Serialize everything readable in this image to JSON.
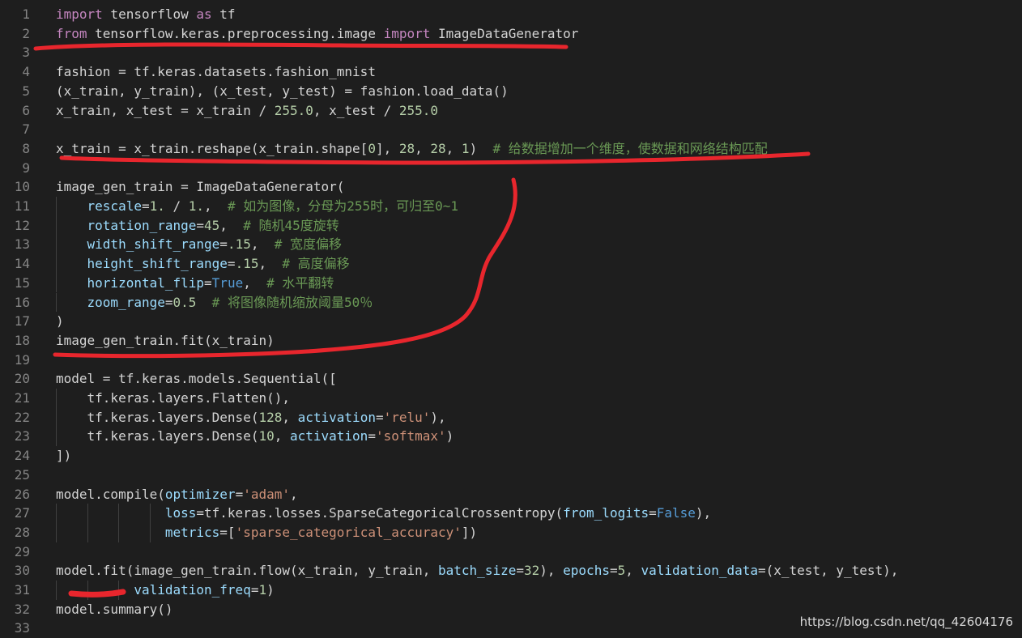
{
  "editor": {
    "lines": [
      {
        "n": "1",
        "guides": 0,
        "tokens": [
          {
            "t": "import",
            "c": "kw"
          },
          {
            "t": " tensorflow "
          },
          {
            "t": "as",
            "c": "kw"
          },
          {
            "t": " tf"
          }
        ]
      },
      {
        "n": "2",
        "guides": 0,
        "tokens": [
          {
            "t": "from",
            "c": "kw"
          },
          {
            "t": " tensorflow.keras.preprocessing.image "
          },
          {
            "t": "import",
            "c": "kw"
          },
          {
            "t": " ImageDataGenerator"
          }
        ]
      },
      {
        "n": "3",
        "guides": 0,
        "tokens": []
      },
      {
        "n": "4",
        "guides": 0,
        "tokens": [
          {
            "t": "fashion = tf.keras.datasets.fashion_mnist"
          }
        ]
      },
      {
        "n": "5",
        "guides": 0,
        "tokens": [
          {
            "t": "(x_train, y_train), (x_test, y_test) = fashion.load_data()"
          }
        ]
      },
      {
        "n": "6",
        "guides": 0,
        "tokens": [
          {
            "t": "x_train, x_test = x_train / "
          },
          {
            "t": "255.0",
            "c": "nm"
          },
          {
            "t": ", x_test / "
          },
          {
            "t": "255.0",
            "c": "nm"
          }
        ]
      },
      {
        "n": "7",
        "guides": 0,
        "tokens": []
      },
      {
        "n": "8",
        "guides": 0,
        "tokens": [
          {
            "t": "x_train = x_train.reshape(x_train.shape["
          },
          {
            "t": "0",
            "c": "nm"
          },
          {
            "t": "], "
          },
          {
            "t": "28",
            "c": "nm"
          },
          {
            "t": ", "
          },
          {
            "t": "28",
            "c": "nm"
          },
          {
            "t": ", "
          },
          {
            "t": "1",
            "c": "nm"
          },
          {
            "t": ")  "
          },
          {
            "t": "# 给数据增加一个维度，使数据和网络结构匹配",
            "c": "cm"
          }
        ]
      },
      {
        "n": "9",
        "guides": 0,
        "tokens": []
      },
      {
        "n": "10",
        "guides": 0,
        "tokens": [
          {
            "t": "image_gen_train = ImageDataGenerator("
          }
        ]
      },
      {
        "n": "11",
        "guides": 1,
        "tokens": [
          {
            "t": "    "
          },
          {
            "t": "rescale",
            "c": "va"
          },
          {
            "t": "="
          },
          {
            "t": "1.",
            "c": "nm"
          },
          {
            "t": " / "
          },
          {
            "t": "1.",
            "c": "nm"
          },
          {
            "t": ",  "
          },
          {
            "t": "# 如为图像，分母为255时，可归至0~1",
            "c": "cm"
          }
        ]
      },
      {
        "n": "12",
        "guides": 1,
        "tokens": [
          {
            "t": "    "
          },
          {
            "t": "rotation_range",
            "c": "va"
          },
          {
            "t": "="
          },
          {
            "t": "45",
            "c": "nm"
          },
          {
            "t": ",  "
          },
          {
            "t": "# 随机45度旋转",
            "c": "cm"
          }
        ]
      },
      {
        "n": "13",
        "guides": 1,
        "tokens": [
          {
            "t": "    "
          },
          {
            "t": "width_shift_range",
            "c": "va"
          },
          {
            "t": "="
          },
          {
            "t": ".15",
            "c": "nm"
          },
          {
            "t": ",  "
          },
          {
            "t": "# 宽度偏移",
            "c": "cm"
          }
        ]
      },
      {
        "n": "14",
        "guides": 1,
        "tokens": [
          {
            "t": "    "
          },
          {
            "t": "height_shift_range",
            "c": "va"
          },
          {
            "t": "="
          },
          {
            "t": ".15",
            "c": "nm"
          },
          {
            "t": ",  "
          },
          {
            "t": "# 高度偏移",
            "c": "cm"
          }
        ]
      },
      {
        "n": "15",
        "guides": 1,
        "tokens": [
          {
            "t": "    "
          },
          {
            "t": "horizontal_flip",
            "c": "va"
          },
          {
            "t": "="
          },
          {
            "t": "True",
            "c": "bl"
          },
          {
            "t": ",  "
          },
          {
            "t": "# 水平翻转",
            "c": "cm"
          }
        ]
      },
      {
        "n": "16",
        "guides": 1,
        "tokens": [
          {
            "t": "    "
          },
          {
            "t": "zoom_range",
            "c": "va"
          },
          {
            "t": "="
          },
          {
            "t": "0.5",
            "c": "nm"
          },
          {
            "t": "  "
          },
          {
            "t": "# 将图像随机缩放阈量50％",
            "c": "cm"
          }
        ]
      },
      {
        "n": "17",
        "guides": 0,
        "tokens": [
          {
            "t": ")"
          }
        ]
      },
      {
        "n": "18",
        "guides": 0,
        "tokens": [
          {
            "t": "image_gen_train.fit(x_train)"
          }
        ]
      },
      {
        "n": "19",
        "guides": 0,
        "tokens": []
      },
      {
        "n": "20",
        "guides": 0,
        "tokens": [
          {
            "t": "model = tf.keras.models.Sequential(["
          }
        ]
      },
      {
        "n": "21",
        "guides": 1,
        "tokens": [
          {
            "t": "    tf.keras.layers.Flatten(),"
          }
        ]
      },
      {
        "n": "22",
        "guides": 1,
        "tokens": [
          {
            "t": "    tf.keras.layers.Dense("
          },
          {
            "t": "128",
            "c": "nm"
          },
          {
            "t": ", "
          },
          {
            "t": "activation",
            "c": "va"
          },
          {
            "t": "="
          },
          {
            "t": "'relu'",
            "c": "st"
          },
          {
            "t": "),"
          }
        ]
      },
      {
        "n": "23",
        "guides": 1,
        "tokens": [
          {
            "t": "    tf.keras.layers.Dense("
          },
          {
            "t": "10",
            "c": "nm"
          },
          {
            "t": ", "
          },
          {
            "t": "activation",
            "c": "va"
          },
          {
            "t": "="
          },
          {
            "t": "'softmax'",
            "c": "st"
          },
          {
            "t": ")"
          }
        ]
      },
      {
        "n": "24",
        "guides": 0,
        "tokens": [
          {
            "t": "])"
          }
        ]
      },
      {
        "n": "25",
        "guides": 0,
        "tokens": []
      },
      {
        "n": "26",
        "guides": 0,
        "tokens": [
          {
            "t": "model.compile("
          },
          {
            "t": "optimizer",
            "c": "va"
          },
          {
            "t": "="
          },
          {
            "t": "'adam'",
            "c": "st"
          },
          {
            "t": ","
          }
        ]
      },
      {
        "n": "27",
        "guides": 4,
        "tokens": [
          {
            "t": "              "
          },
          {
            "t": "loss",
            "c": "va"
          },
          {
            "t": "=tf.keras.losses.SparseCategoricalCrossentropy("
          },
          {
            "t": "from_logits",
            "c": "va"
          },
          {
            "t": "="
          },
          {
            "t": "False",
            "c": "bl"
          },
          {
            "t": "),"
          }
        ]
      },
      {
        "n": "28",
        "guides": 4,
        "tokens": [
          {
            "t": "              "
          },
          {
            "t": "metrics",
            "c": "va"
          },
          {
            "t": "=["
          },
          {
            "t": "'sparse_categorical_accuracy'",
            "c": "st"
          },
          {
            "t": "])"
          }
        ]
      },
      {
        "n": "29",
        "guides": 0,
        "tokens": []
      },
      {
        "n": "30",
        "guides": 0,
        "tokens": [
          {
            "t": "model.fit(image_gen_train.flow(x_train, y_train, "
          },
          {
            "t": "batch_size",
            "c": "va"
          },
          {
            "t": "="
          },
          {
            "t": "32",
            "c": "nm"
          },
          {
            "t": "), "
          },
          {
            "t": "epochs",
            "c": "va"
          },
          {
            "t": "="
          },
          {
            "t": "5",
            "c": "nm"
          },
          {
            "t": ", "
          },
          {
            "t": "validation_data",
            "c": "va"
          },
          {
            "t": "=(x_test, y_test),"
          }
        ]
      },
      {
        "n": "31",
        "guides": 3,
        "tokens": [
          {
            "t": "          "
          },
          {
            "t": "validation_freq",
            "c": "va"
          },
          {
            "t": "="
          },
          {
            "t": "1",
            "c": "nm"
          },
          {
            "t": ")"
          }
        ]
      },
      {
        "n": "32",
        "guides": 0,
        "tokens": [
          {
            "t": "model.summary()"
          }
        ]
      },
      {
        "n": "33",
        "guides": 0,
        "tokens": []
      }
    ]
  },
  "watermark": "https://blog.csdn.net/qq_42604176",
  "colors": {
    "background": "#1e1e1e",
    "annotation": "#e8262d"
  }
}
